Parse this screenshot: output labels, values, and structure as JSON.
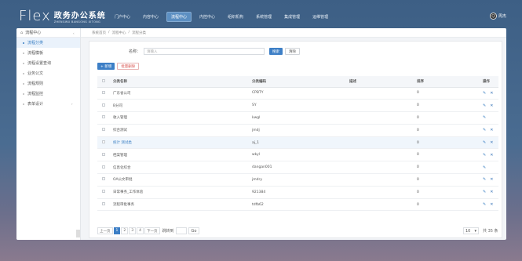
{
  "brand": {
    "logo": "Flex",
    "name_cn": "政务办公系统",
    "name_en": "ZHENGWU BANGONG XITONG"
  },
  "nav": [
    "门户中心",
    "内容中心",
    "流程中心",
    "内控中心",
    "组织机构",
    "系统管理",
    "集成管理",
    "运维管理"
  ],
  "nav_active_index": 2,
  "user": {
    "name": "周杰"
  },
  "sidebar": {
    "header": "流程中心",
    "items": [
      {
        "label": "流程分类",
        "active": true,
        "expandable": false
      },
      {
        "label": "流程模板",
        "active": false,
        "expandable": false
      },
      {
        "label": "流程设置查询",
        "active": false,
        "expandable": false
      },
      {
        "label": "业务公文",
        "active": false,
        "expandable": false
      },
      {
        "label": "流程规则",
        "active": false,
        "expandable": false
      },
      {
        "label": "流程监控",
        "active": false,
        "expandable": false
      },
      {
        "label": "表单设计",
        "active": false,
        "expandable": true
      }
    ]
  },
  "breadcrumb": [
    "系统首页",
    "/",
    "流程中心",
    "/",
    "流程分类"
  ],
  "search": {
    "label": "名称：",
    "placeholder": "请输入",
    "search_btn": "搜索",
    "reset_btn": "清除"
  },
  "actions": {
    "add": "+ 新增",
    "batch_delete": "批量删除"
  },
  "table": {
    "columns": [
      "分类名称",
      "分类编码",
      "描述",
      "排序",
      "操作"
    ],
    "rows": [
      {
        "name": "广东省公司",
        "code": "CPBTY",
        "desc": "",
        "order": "0",
        "deletable": true
      },
      {
        "name": "B分司",
        "code": "SY",
        "desc": "",
        "order": "0",
        "deletable": true
      },
      {
        "name": "收入管理",
        "code": "kwgl",
        "desc": "",
        "order": "0",
        "deletable": false
      },
      {
        "name": "综合测试",
        "code": "jmdj",
        "desc": "",
        "order": "0",
        "deletable": true
      },
      {
        "name": "统计 测试类",
        "code": "aj_1",
        "desc": "",
        "order": "0",
        "deletable": true,
        "highlight": true
      },
      {
        "name": "档案管理",
        "code": "wkyl",
        "desc": "",
        "order": "0",
        "deletable": true
      },
      {
        "name": "信息化综合",
        "code": "dangan001",
        "desc": "",
        "order": "0",
        "deletable": false
      },
      {
        "name": "OA公文审批",
        "code": "jmdry",
        "desc": "",
        "order": "0",
        "deletable": true
      },
      {
        "name": "日常事务_工作体验",
        "code": "921384",
        "desc": "",
        "order": "0",
        "deletable": true
      },
      {
        "name": "流程审批事务",
        "code": "tdfb62",
        "desc": "",
        "order": "0",
        "deletable": true
      }
    ]
  },
  "pagination": {
    "prev": "上一页",
    "pages": [
      "1",
      "2",
      "3",
      "4"
    ],
    "current": "1",
    "next": "下一页",
    "goto_label": "跳转到",
    "go": "Go",
    "page_size": "10",
    "total": "共 35 条"
  },
  "colors": {
    "accent": "#3d7fc6",
    "header_bg": "#3d5f85",
    "danger": "#d9534f"
  }
}
